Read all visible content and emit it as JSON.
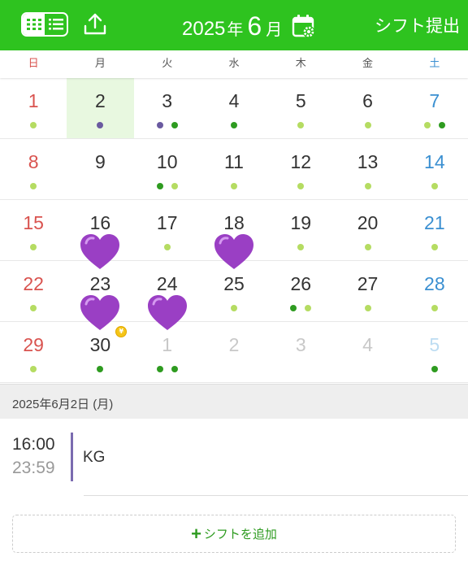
{
  "header": {
    "year": "2025",
    "year_unit": "年",
    "month": "6",
    "month_unit": "月",
    "submit_label": "シフト提出",
    "background_color": "#2ec31f",
    "icons": [
      "grid-view-icon",
      "list-view-icon",
      "upload-icon",
      "calendar-settings-icon"
    ]
  },
  "weekdays": [
    "日",
    "月",
    "火",
    "水",
    "木",
    "金",
    "土"
  ],
  "colors": {
    "green_dot": "#2e9b20",
    "light_green_dot": "#b5dc62",
    "purple_dot": "#6a5aa0",
    "heart": "#9a3fc4",
    "sunday": "#d9534f",
    "saturday": "#3a8fd1"
  },
  "calendar": {
    "weeks": [
      [
        {
          "day": "1",
          "dots": [
            "light"
          ]
        },
        {
          "day": "2",
          "dots": [
            "purple"
          ],
          "selected": true
        },
        {
          "day": "3",
          "dots": [
            "purple",
            "green"
          ]
        },
        {
          "day": "4",
          "dots": [
            "green"
          ]
        },
        {
          "day": "5",
          "dots": [
            "light"
          ]
        },
        {
          "day": "6",
          "dots": [
            "light"
          ]
        },
        {
          "day": "7",
          "dots": [
            "light",
            "green"
          ]
        }
      ],
      [
        {
          "day": "8",
          "dots": [
            "light"
          ]
        },
        {
          "day": "9",
          "dots": []
        },
        {
          "day": "10",
          "dots": [
            "green",
            "light"
          ]
        },
        {
          "day": "11",
          "dots": [
            "light"
          ]
        },
        {
          "day": "12",
          "dots": [
            "light"
          ]
        },
        {
          "day": "13",
          "dots": [
            "light"
          ]
        },
        {
          "day": "14",
          "dots": [
            "light"
          ]
        }
      ],
      [
        {
          "day": "15",
          "dots": [
            "light"
          ]
        },
        {
          "day": "16",
          "dots": [],
          "heart": true
        },
        {
          "day": "17",
          "dots": [
            "light"
          ]
        },
        {
          "day": "18",
          "dots": [],
          "heart": true
        },
        {
          "day": "19",
          "dots": [
            "light"
          ]
        },
        {
          "day": "20",
          "dots": [
            "light"
          ]
        },
        {
          "day": "21",
          "dots": [
            "light"
          ]
        }
      ],
      [
        {
          "day": "22",
          "dots": [
            "light"
          ]
        },
        {
          "day": "23",
          "dots": [],
          "heart": true
        },
        {
          "day": "24",
          "dots": [],
          "heart": true
        },
        {
          "day": "25",
          "dots": [
            "light"
          ]
        },
        {
          "day": "26",
          "dots": [
            "green",
            "light"
          ]
        },
        {
          "day": "27",
          "dots": [
            "light"
          ]
        },
        {
          "day": "28",
          "dots": [
            "light"
          ]
        }
      ],
      [
        {
          "day": "29",
          "dots": [
            "light"
          ]
        },
        {
          "day": "30",
          "dots": [
            "green"
          ],
          "badge": true
        },
        {
          "day": "1",
          "dots": [
            "green",
            "green"
          ],
          "other": true
        },
        {
          "day": "2",
          "dots": [],
          "other": true
        },
        {
          "day": "3",
          "dots": [],
          "other": true
        },
        {
          "day": "4",
          "dots": [],
          "other": true
        },
        {
          "day": "5",
          "dots": [
            "green"
          ],
          "other": true
        }
      ]
    ]
  },
  "selected_date": {
    "label": "2025年6月2日 (月)"
  },
  "event": {
    "start": "16:00",
    "end": "23:59",
    "title": "KG"
  },
  "add_shift": {
    "plus": "+",
    "label": "シフトを追加"
  }
}
